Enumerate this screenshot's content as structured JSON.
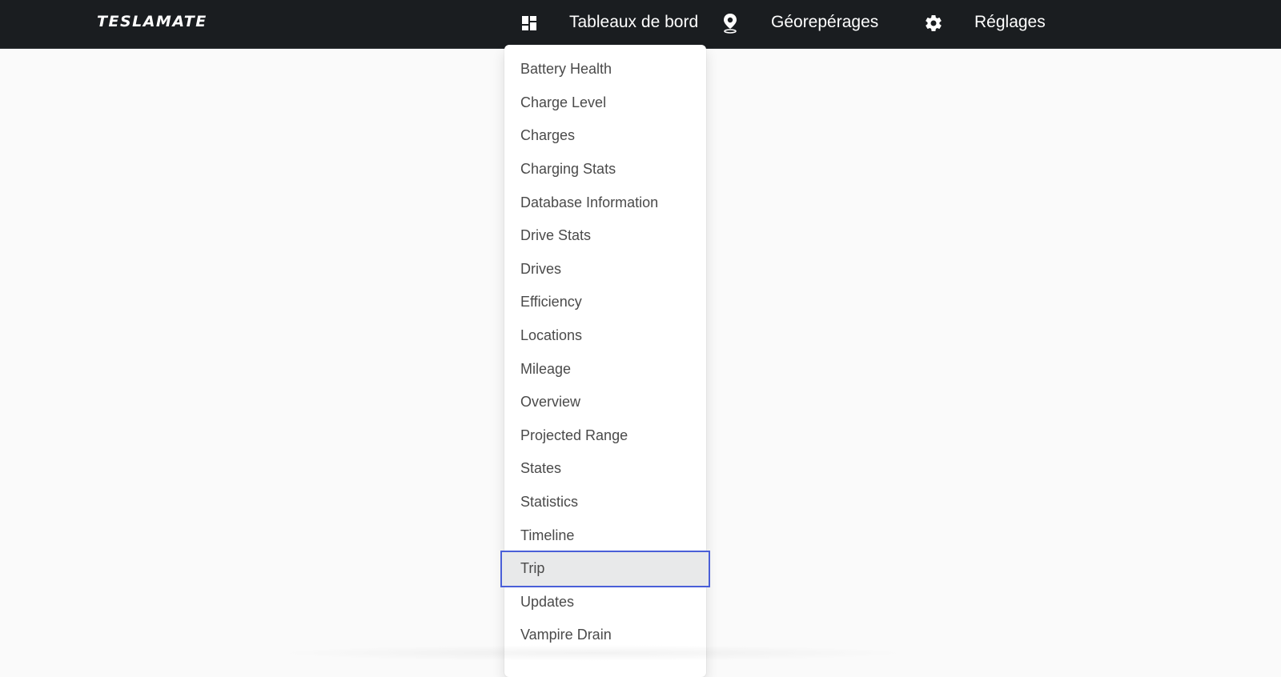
{
  "brand": "TESLAMATE",
  "nav": {
    "dashboards": {
      "label": "Tableaux de bord",
      "icon": "dashboard-icon"
    },
    "geofences": {
      "label": "Géorepérages",
      "icon": "map-marker-icon"
    },
    "settings": {
      "label": "Réglages",
      "icon": "gear-icon"
    }
  },
  "dropdown": {
    "items": [
      "Battery Health",
      "Charge Level",
      "Charges",
      "Charging Stats",
      "Database Information",
      "Drive Stats",
      "Drives",
      "Efficiency",
      "Locations",
      "Mileage",
      "Overview",
      "Projected Range",
      "States",
      "Statistics",
      "Timeline",
      "Trip",
      "Updates",
      "Vampire Drain"
    ],
    "active": "Trip"
  },
  "colors": {
    "navbar": "#1a1d20",
    "background": "#fafafa",
    "focus_outline": "#4a5fd8",
    "active_item_bg": "#e8e9ea"
  }
}
